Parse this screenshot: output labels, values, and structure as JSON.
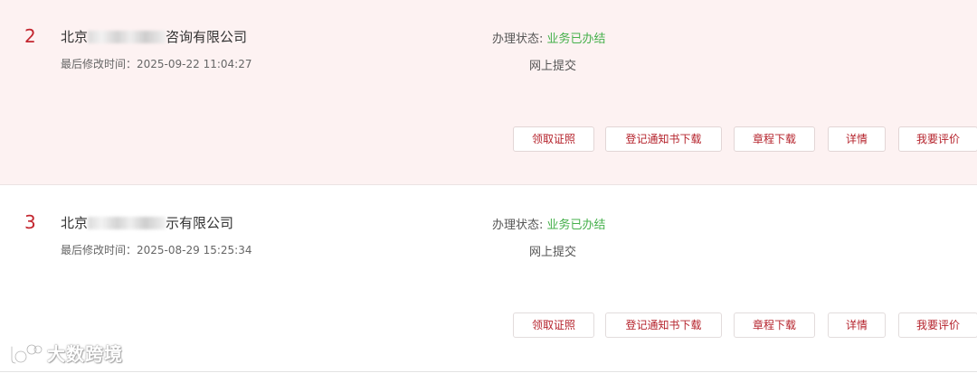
{
  "records": [
    {
      "index": "2",
      "name_prefix": "北京",
      "name_suffix": "咨询有限公司",
      "modified_label": "最后修改时间：",
      "modified_time": "2025-09-22 11:04:27",
      "status_label": "办理状态: ",
      "status_value": "业务已办结",
      "channel": "网上提交",
      "actions": [
        "领取证照",
        "登记通知书下载",
        "章程下载",
        "详情",
        "我要评价"
      ]
    },
    {
      "index": "3",
      "name_prefix": "北京",
      "name_suffix": "示有限公司",
      "modified_label": "最后修改时间：",
      "modified_time": "2025-08-29 15:25:34",
      "status_label": "办理状态: ",
      "status_value": "业务已办结",
      "channel": "网上提交",
      "actions": [
        "领取证照",
        "登记通知书下载",
        "章程下载",
        "详情",
        "我要评价"
      ]
    }
  ],
  "watermark": {
    "text": "大数跨境",
    "icon": "logo-icon"
  },
  "colors": {
    "accent_red": "#c3262f",
    "status_green": "#45b04b",
    "highlight_row_bg": "#fdf2f2"
  }
}
